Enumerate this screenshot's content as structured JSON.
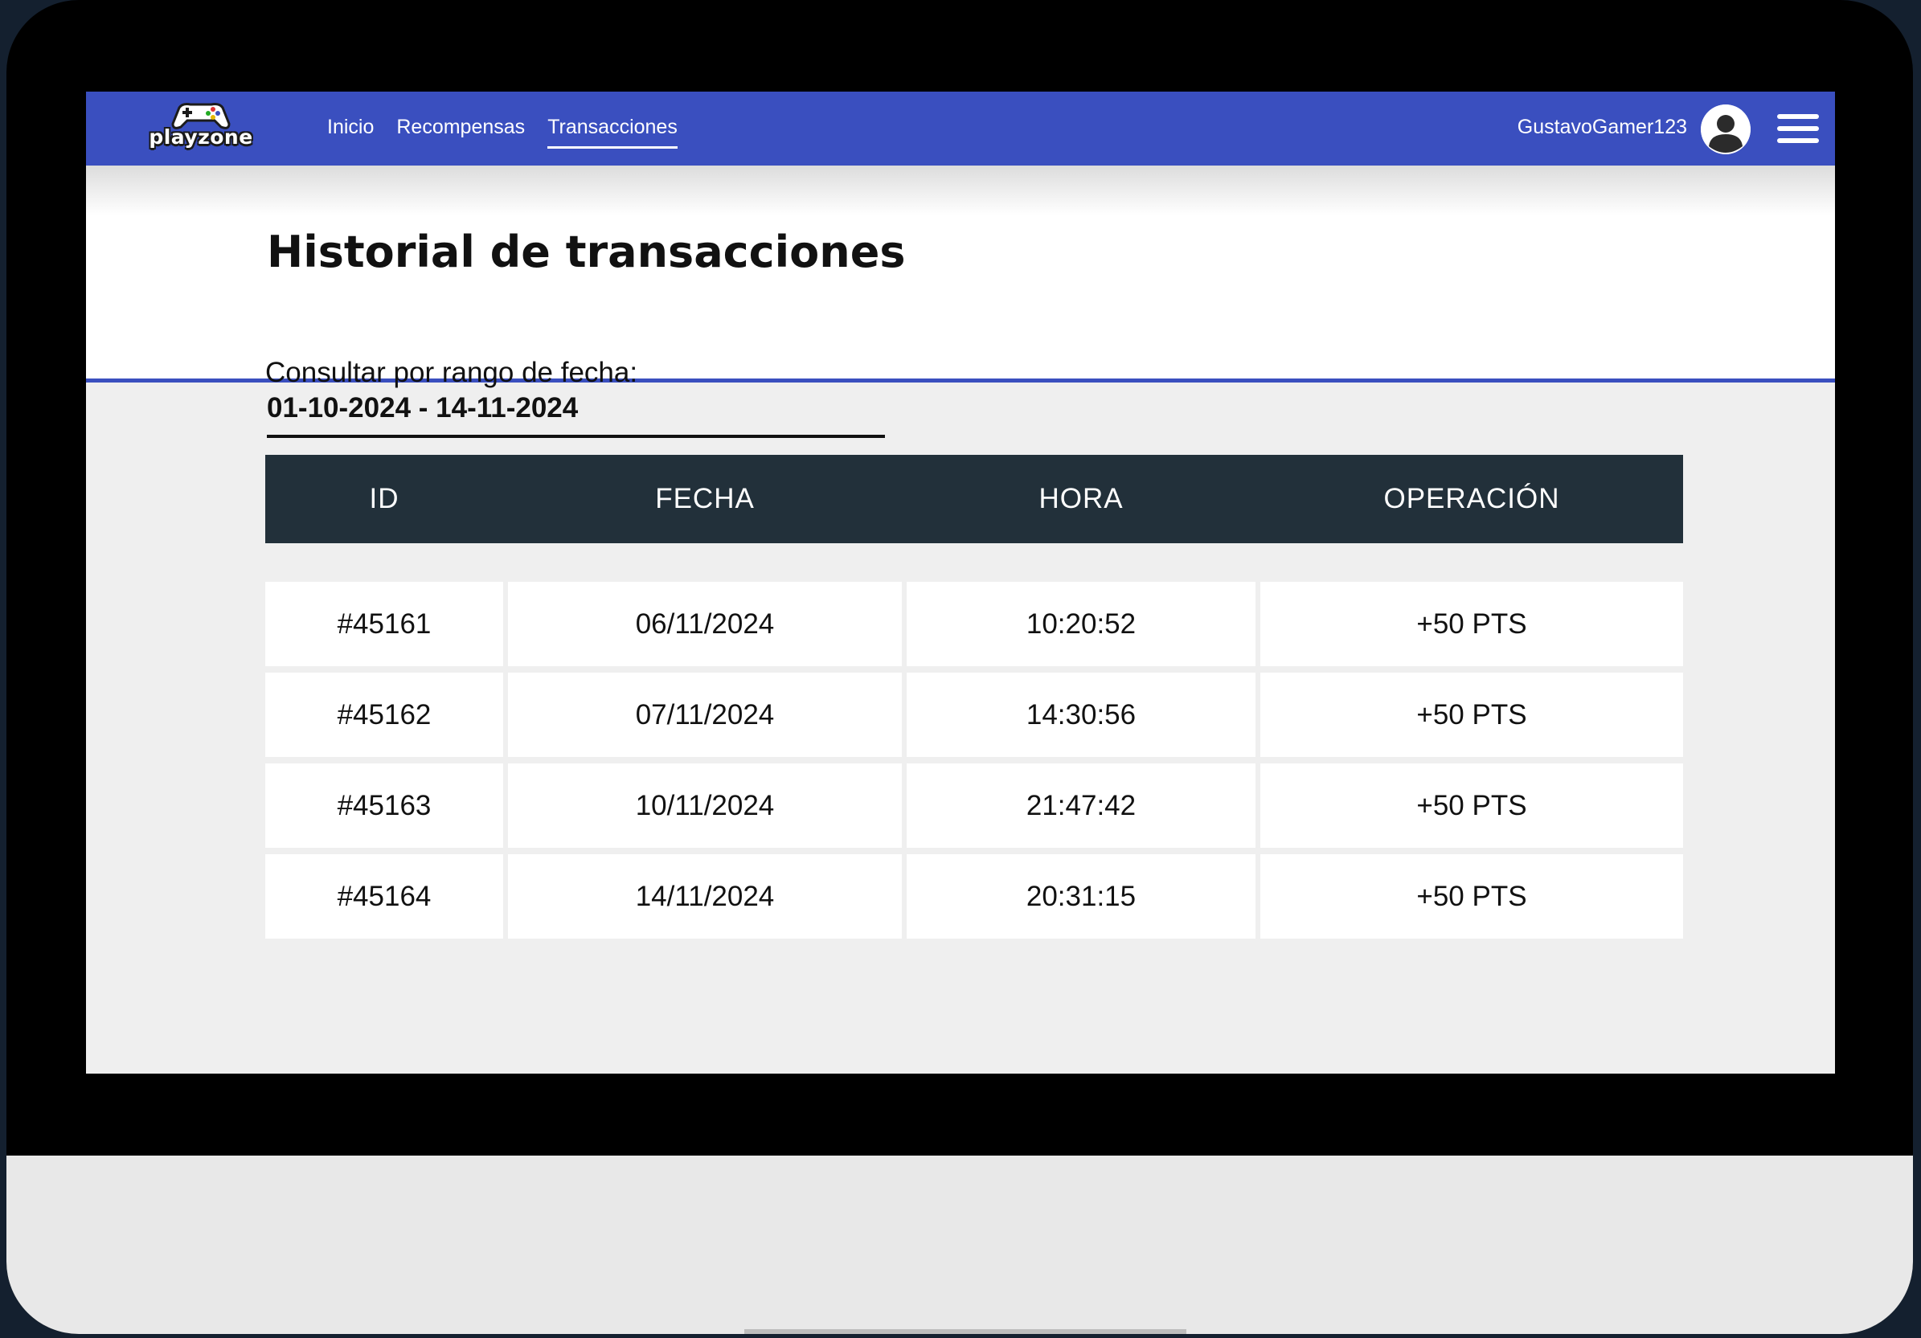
{
  "header": {
    "logo_text": "playzone",
    "nav": [
      {
        "label": "Inicio"
      },
      {
        "label": "Recompensas"
      },
      {
        "label": "Transacciones",
        "active": true
      }
    ],
    "username": "GustavoGamer123"
  },
  "page": {
    "title": "Historial de transacciones"
  },
  "filter": {
    "label": "Consultar por rango de fecha:",
    "value": "01-10-2024 - 14-11-2024"
  },
  "table": {
    "columns": [
      "ID",
      "FECHA",
      "HORA",
      "OPERACIÓN"
    ],
    "rows": [
      {
        "id": "#45161",
        "fecha": "06/11/2024",
        "hora": "10:20:52",
        "operacion": "+50 PTS"
      },
      {
        "id": "#45162",
        "fecha": "07/11/2024",
        "hora": "14:30:56",
        "operacion": "+50 PTS"
      },
      {
        "id": "#45163",
        "fecha": "10/11/2024",
        "hora": "21:47:42",
        "operacion": "+50 PTS"
      },
      {
        "id": "#45164",
        "fecha": "14/11/2024",
        "hora": "20:31:15",
        "operacion": "+50 PTS"
      }
    ]
  },
  "colors": {
    "brand_blue": "#3a4fbf",
    "table_header": "#22303a",
    "page_bg": "#efefef"
  },
  "icons": [
    "gamepad-icon",
    "user-avatar-icon",
    "hamburger-menu-icon"
  ]
}
